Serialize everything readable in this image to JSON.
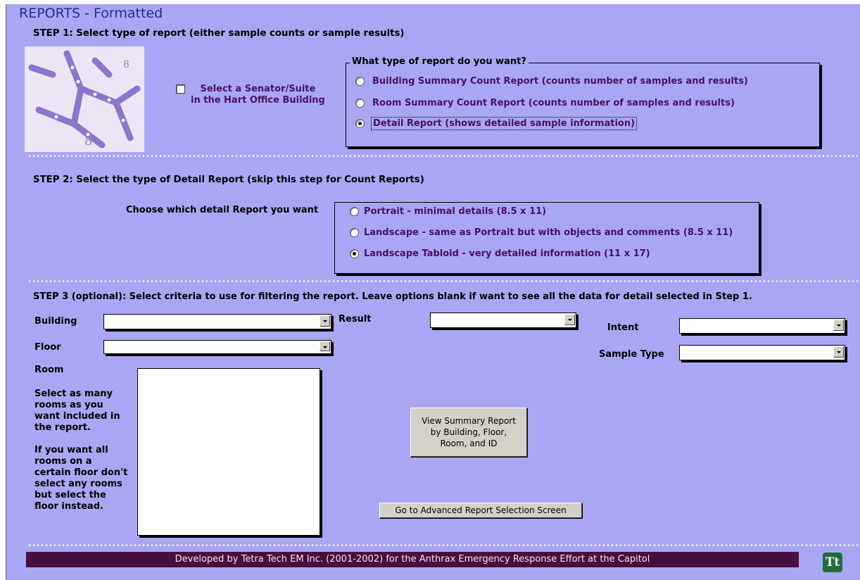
{
  "title": "REPORTS - Formatted",
  "step1": {
    "heading": "STEP 1:  Select type of report (either sample counts or sample results)",
    "senator_checkbox_label": "Select a Senator/Suite\nin the Hart Office Building",
    "senator_checked": false,
    "group_legend": "What type of report do you want?",
    "options": [
      {
        "label": "Building Summary Count Report (counts number of samples and results)",
        "selected": false
      },
      {
        "label": "Room Summary Count Report (counts number of samples and results)",
        "selected": false
      },
      {
        "label": "Detail Report (shows detailed sample information)",
        "selected": true
      }
    ]
  },
  "step2": {
    "heading": "STEP 2:  Select the type of Detail Report (skip this step for Count Reports)",
    "prompt": "Choose which detail  Report you want",
    "options": [
      {
        "label": "Portrait - minimal details (8.5 x 11)",
        "selected": false
      },
      {
        "label": "Landscape - same as Portrait but with objects and comments (8.5 x 11)",
        "selected": false
      },
      {
        "label": "Landscape Tabloid - very detailed information (11 x 17)",
        "selected": true
      }
    ]
  },
  "step3": {
    "heading": "STEP 3 (optional):  Select criteria to use for filtering the report.  Leave options blank if want to see all the data for detail selected in Step 1.",
    "building_label": "Building",
    "building_value": "",
    "floor_label": "Floor",
    "floor_value": "",
    "result_label": "Result",
    "result_value": "",
    "intent_label": "Intent",
    "intent_value": "",
    "sample_type_label": "Sample Type",
    "sample_type_value": "",
    "room_label": "Room",
    "room_help": "Select as many\nrooms as you\nwant included in\nthe report.\n\nIf you want all\nrooms on a\ncertain floor don't\nselect any rooms\nbut select the\nfloor instead."
  },
  "buttons": {
    "view_summary": "View Summary Report\nby Building, Floor,\nRoom, and ID",
    "advanced": "Go to Advanced Report Selection Screen"
  },
  "footer": "Developed by Tetra Tech EM Inc. (2001-2002) for the Anthrax Emergency Response Effort at the Capitol",
  "logo_text": "Tt",
  "colors": {
    "form_bg": "#a9a7f4",
    "footer_bg": "#4a0e3c",
    "option_text": "#4a1060"
  }
}
